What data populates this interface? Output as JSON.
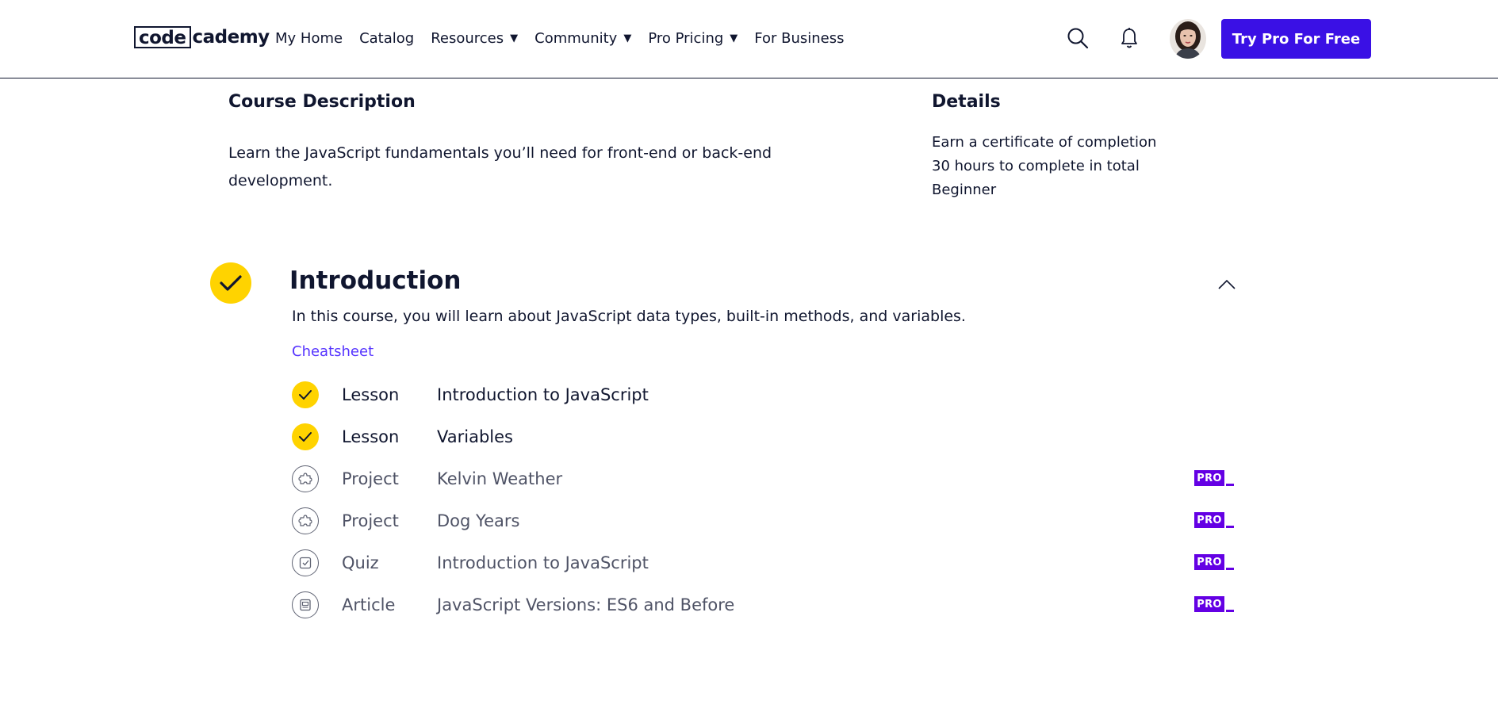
{
  "header": {
    "logo_left": "code",
    "logo_right": "cademy",
    "nav": [
      {
        "label": "My Home",
        "has_caret": false
      },
      {
        "label": "Catalog",
        "has_caret": false
      },
      {
        "label": "Resources",
        "has_caret": true
      },
      {
        "label": "Community",
        "has_caret": true
      },
      {
        "label": "Pro Pricing",
        "has_caret": true
      },
      {
        "label": "For Business",
        "has_caret": false
      }
    ],
    "caret_glyph": "▼",
    "cta_label": "Try Pro For Free",
    "icons": [
      "search-icon",
      "bell-icon"
    ]
  },
  "course": {
    "description_heading": "Course Description",
    "description": "Learn the JavaScript fundamentals you’ll need for front-end or back-end development.",
    "details_heading": "Details",
    "details": [
      "Earn a certificate of completion",
      "30 hours to complete in total",
      "Beginner"
    ]
  },
  "module": {
    "title": "Introduction",
    "description": "In this course, you will learn about JavaScript data types, built-in methods, and variables.",
    "cheatsheet_label": "Cheatsheet",
    "pro_badge": "PRO",
    "items": [
      {
        "type": "Lesson",
        "title": "Introduction to JavaScript",
        "status": "complete",
        "icon": "check-icon",
        "pro": false
      },
      {
        "type": "Lesson",
        "title": "Variables",
        "status": "complete",
        "icon": "check-icon",
        "pro": false
      },
      {
        "type": "Project",
        "title": "Kelvin Weather",
        "status": "locked",
        "icon": "puzzle-icon",
        "pro": true
      },
      {
        "type": "Project",
        "title": "Dog Years",
        "status": "locked",
        "icon": "puzzle-icon",
        "pro": true
      },
      {
        "type": "Quiz",
        "title": "Introduction to JavaScript",
        "status": "locked",
        "icon": "quiz-icon",
        "pro": true
      },
      {
        "type": "Article",
        "title": "JavaScript Versions: ES6 and Before",
        "status": "locked",
        "icon": "article-icon",
        "pro": true
      }
    ]
  },
  "colors": {
    "brand": "#3a10e5",
    "pro": "#6400e4",
    "complete": "#ffd300",
    "link": "#5533ff",
    "text": "#10162f"
  }
}
